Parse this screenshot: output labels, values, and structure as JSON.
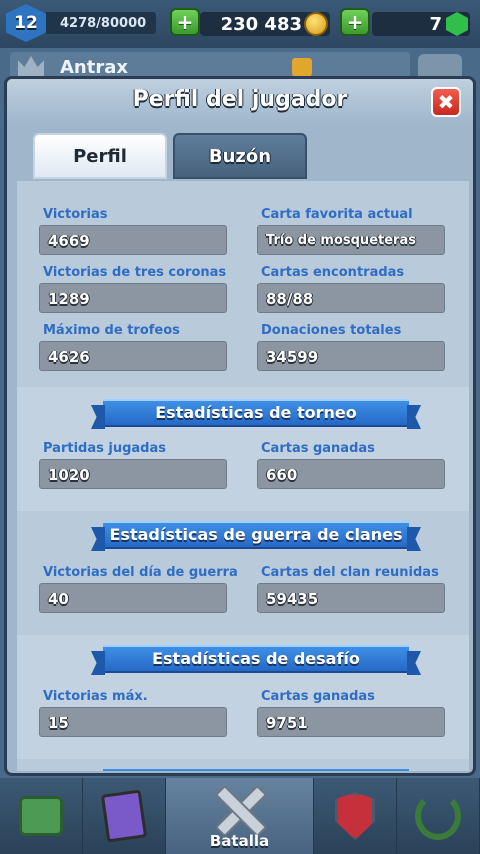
{
  "topbar": {
    "level": "12",
    "xp": "4278/80000",
    "gold": "230 483",
    "gems": "7",
    "add_gold_label": "+",
    "add_gems_label": "+"
  },
  "background": {
    "player_name": "Antrax"
  },
  "modal": {
    "title": "Perfil del jugador",
    "close_label": "✖",
    "tabs": [
      {
        "label": "Perfil",
        "active": true
      },
      {
        "label": "Buzón",
        "active": false
      }
    ]
  },
  "profile": {
    "stats": [
      {
        "label": "Victorias",
        "value": "4669"
      },
      {
        "label": "Carta favorita actual",
        "value": "Trío de mosqueteras"
      },
      {
        "label": "Victorias de tres coronas",
        "value": "1289"
      },
      {
        "label": "Cartas encontradas",
        "value": "88/88"
      },
      {
        "label": "Máximo de trofeos",
        "value": "4626"
      },
      {
        "label": "Donaciones totales",
        "value": "34599"
      }
    ]
  },
  "tournament": {
    "title": "Estadísticas de torneo",
    "stats": [
      {
        "label": "Partidas jugadas",
        "value": "1020"
      },
      {
        "label": "Cartas ganadas",
        "value": "660"
      }
    ]
  },
  "clan_war": {
    "title": "Estadísticas de guerra de clanes",
    "stats": [
      {
        "label": "Victorias del día de guerra",
        "value": "40"
      },
      {
        "label": "Cartas del clan reunidas",
        "value": "59435"
      }
    ]
  },
  "challenge": {
    "title": "Estadísticas de desafío",
    "stats": [
      {
        "label": "Victorias máx.",
        "value": "15"
      },
      {
        "label": "Cartas ganadas",
        "value": "9751"
      }
    ]
  },
  "bottom_nav": {
    "items": [
      {
        "icon": "chest-icon"
      },
      {
        "icon": "cards-icon"
      },
      {
        "icon": "crossed-swords-icon",
        "label": "Batalla",
        "active": true
      },
      {
        "icon": "clan-shield-icon"
      },
      {
        "icon": "laurel-sword-icon"
      }
    ]
  },
  "colors": {
    "stat_label": "#2f6dc4",
    "ribbon": "#2f7bd6",
    "close_button": "#d8352a",
    "plus_button": "#4fb23f"
  }
}
